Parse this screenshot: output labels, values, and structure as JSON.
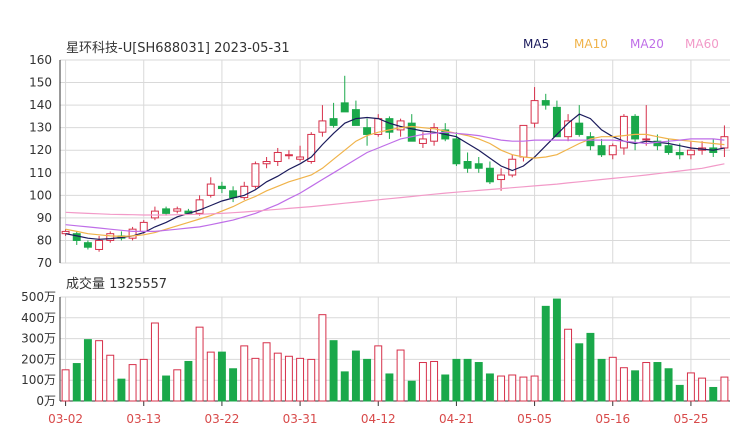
{
  "header": {
    "title": "星环科技-U[SH688031] 2023-05-31"
  },
  "legend": [
    {
      "label": "MA5",
      "color": "#1b1b5c"
    },
    {
      "label": "MA10",
      "color": "#f0b34a"
    },
    {
      "label": "MA20",
      "color": "#bf6ee8"
    },
    {
      "label": "MA60",
      "color": "#f29ac8"
    }
  ],
  "volume_title": "成交量 1325557",
  "colors": {
    "up": "#d6304a",
    "down": "#1aa84a",
    "grid": "#d9d9d9",
    "axis": "#333333"
  },
  "chart_data": [
    {
      "type": "candlestick",
      "ylim": [
        70,
        160
      ],
      "yticks": [
        "160",
        "150",
        "140",
        "130",
        "120",
        "110",
        "100",
        "90",
        "80",
        "70"
      ],
      "xticks": [
        "03-02",
        "03-13",
        "03-22",
        "03-31",
        "04-12",
        "04-21",
        "05-05",
        "05-16",
        "05-25"
      ],
      "xtick_index": [
        0,
        7,
        14,
        21,
        28,
        35,
        42,
        49,
        56
      ],
      "ohlc": [
        [
          83,
          85,
          82,
          84
        ],
        [
          83,
          84,
          78,
          80
        ],
        [
          79,
          80,
          76,
          77
        ],
        [
          76,
          82,
          75,
          80
        ],
        [
          80,
          84,
          79,
          83
        ],
        [
          82,
          84,
          80,
          81
        ],
        [
          81,
          86,
          80,
          85
        ],
        [
          84,
          89,
          83,
          88
        ],
        [
          90,
          95,
          89,
          93
        ],
        [
          94,
          95,
          91,
          92
        ],
        [
          93,
          95,
          92,
          94
        ],
        [
          93,
          94,
          92,
          92
        ],
        [
          92,
          100,
          91,
          98
        ],
        [
          100,
          108,
          99,
          105
        ],
        [
          104,
          106,
          101,
          103
        ],
        [
          102,
          104,
          97,
          99
        ],
        [
          99,
          106,
          98,
          104
        ],
        [
          104,
          115,
          103,
          114
        ],
        [
          114,
          117,
          112,
          115
        ],
        [
          115,
          121,
          113,
          119
        ],
        [
          118,
          120,
          116,
          118
        ],
        [
          116,
          122,
          115,
          117
        ],
        [
          115,
          128,
          114,
          127
        ],
        [
          128,
          140,
          126,
          133
        ],
        [
          134,
          141,
          130,
          131
        ],
        [
          141,
          153,
          140,
          137
        ],
        [
          138,
          142,
          135,
          131
        ],
        [
          130,
          134,
          122,
          127
        ],
        [
          127,
          136,
          126,
          134
        ],
        [
          134,
          135,
          125,
          128
        ],
        [
          129,
          134,
          126,
          133
        ],
        [
          132,
          136,
          125,
          124
        ],
        [
          123,
          128,
          121,
          125
        ],
        [
          124,
          132,
          122,
          130
        ],
        [
          129,
          132,
          124,
          125
        ],
        [
          125,
          128,
          113,
          114
        ],
        [
          115,
          119,
          110,
          112
        ],
        [
          114,
          117,
          110,
          112
        ],
        [
          112,
          115,
          105,
          106
        ],
        [
          107,
          112,
          102,
          109
        ],
        [
          109,
          118,
          108,
          116
        ],
        [
          117,
          131,
          115,
          131
        ],
        [
          132,
          148,
          130,
          142
        ],
        [
          142,
          145,
          138,
          140
        ],
        [
          139,
          142,
          126,
          126
        ],
        [
          126,
          136,
          124,
          133
        ],
        [
          132,
          140,
          126,
          127
        ],
        [
          126,
          128,
          120,
          122
        ],
        [
          122,
          125,
          117,
          118
        ],
        [
          118,
          123,
          116,
          122
        ],
        [
          121,
          136,
          118,
          135
        ],
        [
          135,
          136,
          120,
          125
        ],
        [
          125,
          140,
          122,
          125
        ],
        [
          124,
          127,
          120,
          122
        ],
        [
          122,
          125,
          118,
          119
        ],
        [
          119,
          123,
          116,
          118
        ],
        [
          118,
          124,
          116,
          120
        ],
        [
          120,
          124,
          118,
          121
        ],
        [
          121,
          125,
          117,
          119
        ],
        [
          121,
          131,
          117,
          126
        ]
      ],
      "ma5": [
        83,
        82,
        81,
        80.5,
        80.8,
        81.3,
        82,
        83.5,
        86,
        88,
        90.5,
        92,
        93.5,
        95.5,
        97.5,
        98.8,
        100,
        102.5,
        106,
        108.5,
        111.5,
        114,
        117,
        122.5,
        127.5,
        132,
        134,
        134.5,
        134,
        132,
        130.5,
        129.5,
        128.5,
        128,
        127,
        126,
        123,
        120,
        116.5,
        113,
        111,
        113,
        117,
        122,
        127,
        132,
        136,
        134,
        129,
        126,
        124,
        123,
        124,
        123.5,
        123,
        122,
        121,
        120.5,
        120,
        121
      ],
      "ma10": [
        85,
        84,
        83,
        82.5,
        82,
        81.8,
        82,
        82.5,
        83.5,
        85,
        86.5,
        88,
        89.5,
        91,
        93,
        95,
        97.5,
        99.5,
        102,
        104,
        106,
        107.5,
        109,
        112,
        116,
        120,
        124,
        126.5,
        128,
        129,
        130,
        130.5,
        130,
        129.5,
        128.5,
        127.5,
        126.5,
        125,
        123,
        120,
        118,
        117,
        116.5,
        117,
        118,
        120.5,
        123,
        125,
        126,
        126,
        126.5,
        127,
        127,
        126,
        125,
        124.5,
        124,
        123.5,
        123,
        122.5
      ],
      "ma20": [
        87,
        86.5,
        86,
        85.5,
        85,
        84.5,
        84,
        84,
        84,
        84.5,
        85,
        85.5,
        86,
        87,
        88,
        89,
        90.5,
        92,
        94,
        96,
        98.5,
        101,
        104,
        107,
        110,
        113,
        116,
        119,
        121,
        123,
        125,
        126,
        127,
        127.5,
        128,
        127.5,
        127,
        126.5,
        125.5,
        124.5,
        124,
        124,
        124.5,
        124.5,
        124.5,
        124.5,
        124.5,
        124.5,
        124.5,
        124.5,
        124,
        123.5,
        123,
        123.5,
        124,
        124.5,
        125,
        125,
        125,
        124.5
      ],
      "ma60": [
        92.5,
        92.2,
        92,
        91.8,
        91.6,
        91.5,
        91.4,
        91.3,
        91.3,
        91.3,
        91.4,
        91.5,
        91.6,
        91.8,
        92,
        92.3,
        92.6,
        93,
        93.4,
        93.8,
        94.2,
        94.6,
        95,
        95.5,
        96,
        96.5,
        97,
        97.5,
        98,
        98.5,
        99,
        99.5,
        100,
        100.5,
        101,
        101.4,
        101.8,
        102.2,
        102.6,
        103,
        103.4,
        103.8,
        104.2,
        104.6,
        105,
        105.5,
        106,
        106.5,
        107,
        107.5,
        108,
        108.5,
        109,
        109.6,
        110.2,
        110.8,
        111.4,
        112,
        113,
        114
      ]
    },
    {
      "type": "bar",
      "ylim": [
        0,
        500
      ],
      "yticks": [
        "500万",
        "400万",
        "300万",
        "200万",
        "100万",
        "0万"
      ],
      "unit": "万",
      "values": [
        150,
        180,
        295,
        290,
        220,
        105,
        175,
        200,
        375,
        120,
        150,
        190,
        355,
        235,
        235,
        155,
        265,
        205,
        280,
        230,
        215,
        205,
        200,
        415,
        290,
        140,
        240,
        200,
        265,
        130,
        245,
        95,
        185,
        190,
        125,
        200,
        200,
        185,
        130,
        120,
        125,
        115,
        120,
        455,
        490,
        345,
        275,
        325,
        200,
        210,
        160,
        145,
        185,
        185,
        155,
        75,
        135,
        110,
        65,
        115,
        110
      ]
    }
  ]
}
